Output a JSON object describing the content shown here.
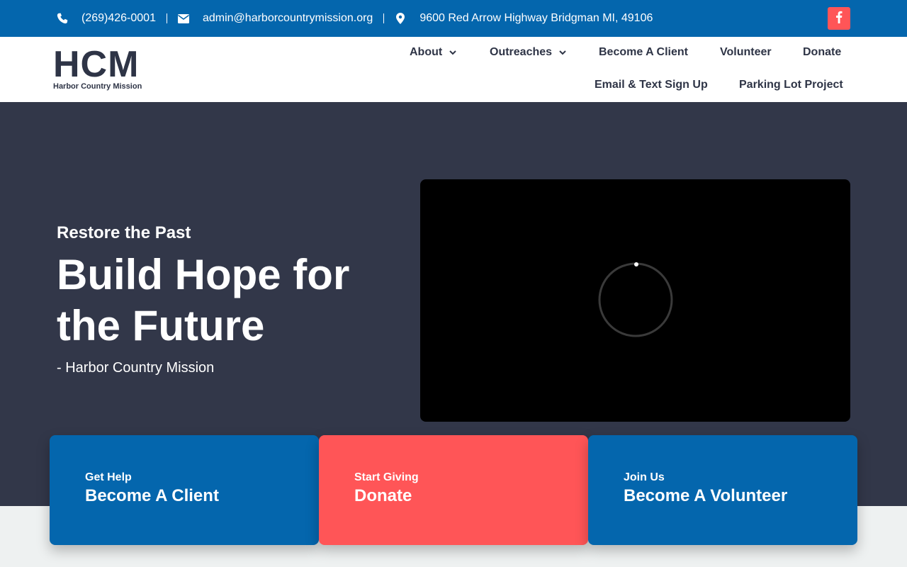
{
  "topbar": {
    "phone": "(269)426-0001",
    "email": "admin@harborcountrymission.org",
    "address": "9600 Red Arrow Highway Bridgman MI, 49106",
    "icons": [
      "phone-icon",
      "envelope-icon",
      "map-pin-icon",
      "facebook-icon"
    ],
    "bg_color": "#0466ad",
    "social_color": "#ff5557"
  },
  "logo": {
    "mark": "HCM",
    "name": "Harbor Country Mission"
  },
  "nav": {
    "about": "About",
    "outreaches": "Outreaches",
    "become_client": "Become A Client",
    "volunteer": "Volunteer",
    "donate": "Donate",
    "email_signup": "Email & Text Sign Up",
    "parking_lot": "Parking Lot Project"
  },
  "hero": {
    "kicker": "Restore the Past",
    "headline": "Build Hope for the Future",
    "attribution": "- Harbor Country Mission",
    "bg_color": "#323749"
  },
  "cards": [
    {
      "kicker": "Get Help",
      "title": "Become A Client",
      "color": "#0466ad"
    },
    {
      "kicker": "Start Giving",
      "title": "Donate",
      "color": "#ff5557"
    },
    {
      "kicker": "Join Us",
      "title": "Become A Volunteer",
      "color": "#0466ad"
    }
  ]
}
